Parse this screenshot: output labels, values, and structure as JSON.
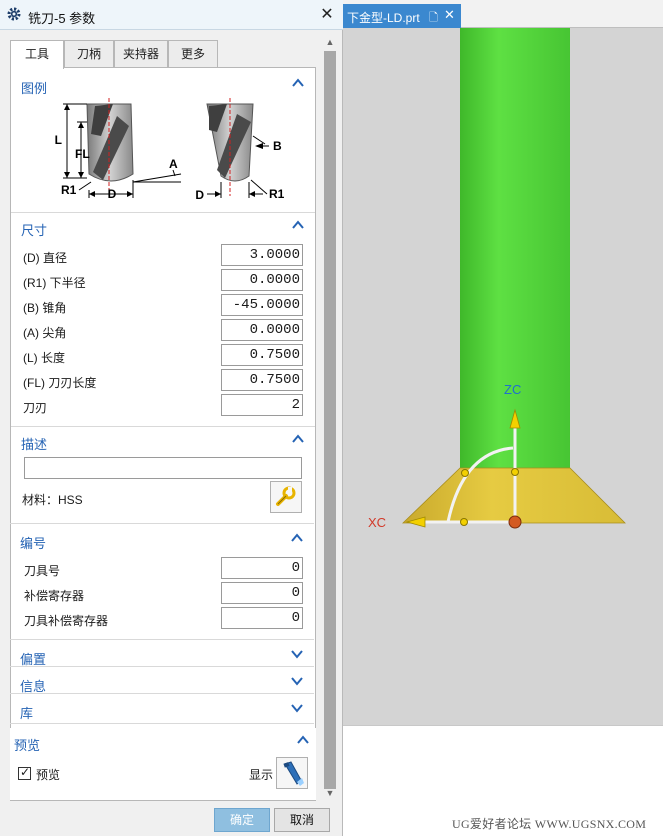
{
  "dialog": {
    "title": "铣刀-5 参数",
    "close_glyph": "✕",
    "tabs": [
      {
        "label": "工具",
        "active": true
      },
      {
        "label": "刀柄",
        "active": false
      },
      {
        "label": "夹持器",
        "active": false
      },
      {
        "label": "更多",
        "active": false
      }
    ],
    "sections": {
      "legend": {
        "title": "图例",
        "expanded": true
      },
      "dimensions": {
        "title": "尺寸",
        "expanded": true
      },
      "description": {
        "title": "描述",
        "expanded": true
      },
      "numbering": {
        "title": "编号",
        "expanded": true
      },
      "offset": {
        "title": "偏置",
        "expanded": false
      },
      "info": {
        "title": "信息",
        "expanded": false
      },
      "library": {
        "title": "库",
        "expanded": false
      },
      "preview": {
        "title": "预览",
        "expanded": true
      }
    },
    "legend_labels": {
      "L": "L",
      "FL": "FL",
      "A": "A",
      "B": "B",
      "D1": "D",
      "D2": "D",
      "R1a": "R1",
      "R1b": "R1"
    },
    "dimensions": [
      {
        "label": "(D) 直径",
        "value": "3.0000"
      },
      {
        "label": "(R1) 下半径",
        "value": "0.0000"
      },
      {
        "label": "(B) 锥角",
        "value": "-45.0000"
      },
      {
        "label": "(A) 尖角",
        "value": "0.0000"
      },
      {
        "label": "(L) 长度",
        "value": "0.7500"
      },
      {
        "label": "(FL) 刀刃长度",
        "value": "0.7500"
      },
      {
        "label": "刀刃",
        "value": "2"
      }
    ],
    "description": {
      "value": "",
      "material_label": "材料：HSS"
    },
    "numbering": [
      {
        "label": "刀具号",
        "value": "0"
      },
      {
        "label": "补偿寄存器",
        "value": "0"
      },
      {
        "label": "刀具补偿寄存器",
        "value": "0"
      }
    ],
    "preview": {
      "checkbox_label": "预览",
      "checked": true,
      "checkmark": "✓",
      "show_label": "显示"
    },
    "buttons": {
      "ok": "确定",
      "cancel": "取消"
    },
    "scroll_up": "▲",
    "scroll_down": "▼"
  },
  "viewport": {
    "doc_tab_label": "下金型-LD.prt",
    "doc_tab_close": "✕",
    "doc_tab_icon": "🗋",
    "axis_z_label": "ZC",
    "axis_x_label": "XC"
  },
  "watermark": "UG爱好者论坛 WWW.UGSNX.COM",
  "colors": {
    "accent": "#2563b4",
    "tool_green": "#55d33b",
    "cone_yellow": "#e0c43a",
    "viewport_bg": "#d4d4d4",
    "doc_tab": "#3b88cf",
    "ok_button": "#8fbfe0"
  },
  "icons": {
    "title": "gear-icon",
    "material": "wrench-icon",
    "show": "flashlight-icon",
    "collapse": "chevron-up-icon",
    "expand": "chevron-down-icon"
  }
}
